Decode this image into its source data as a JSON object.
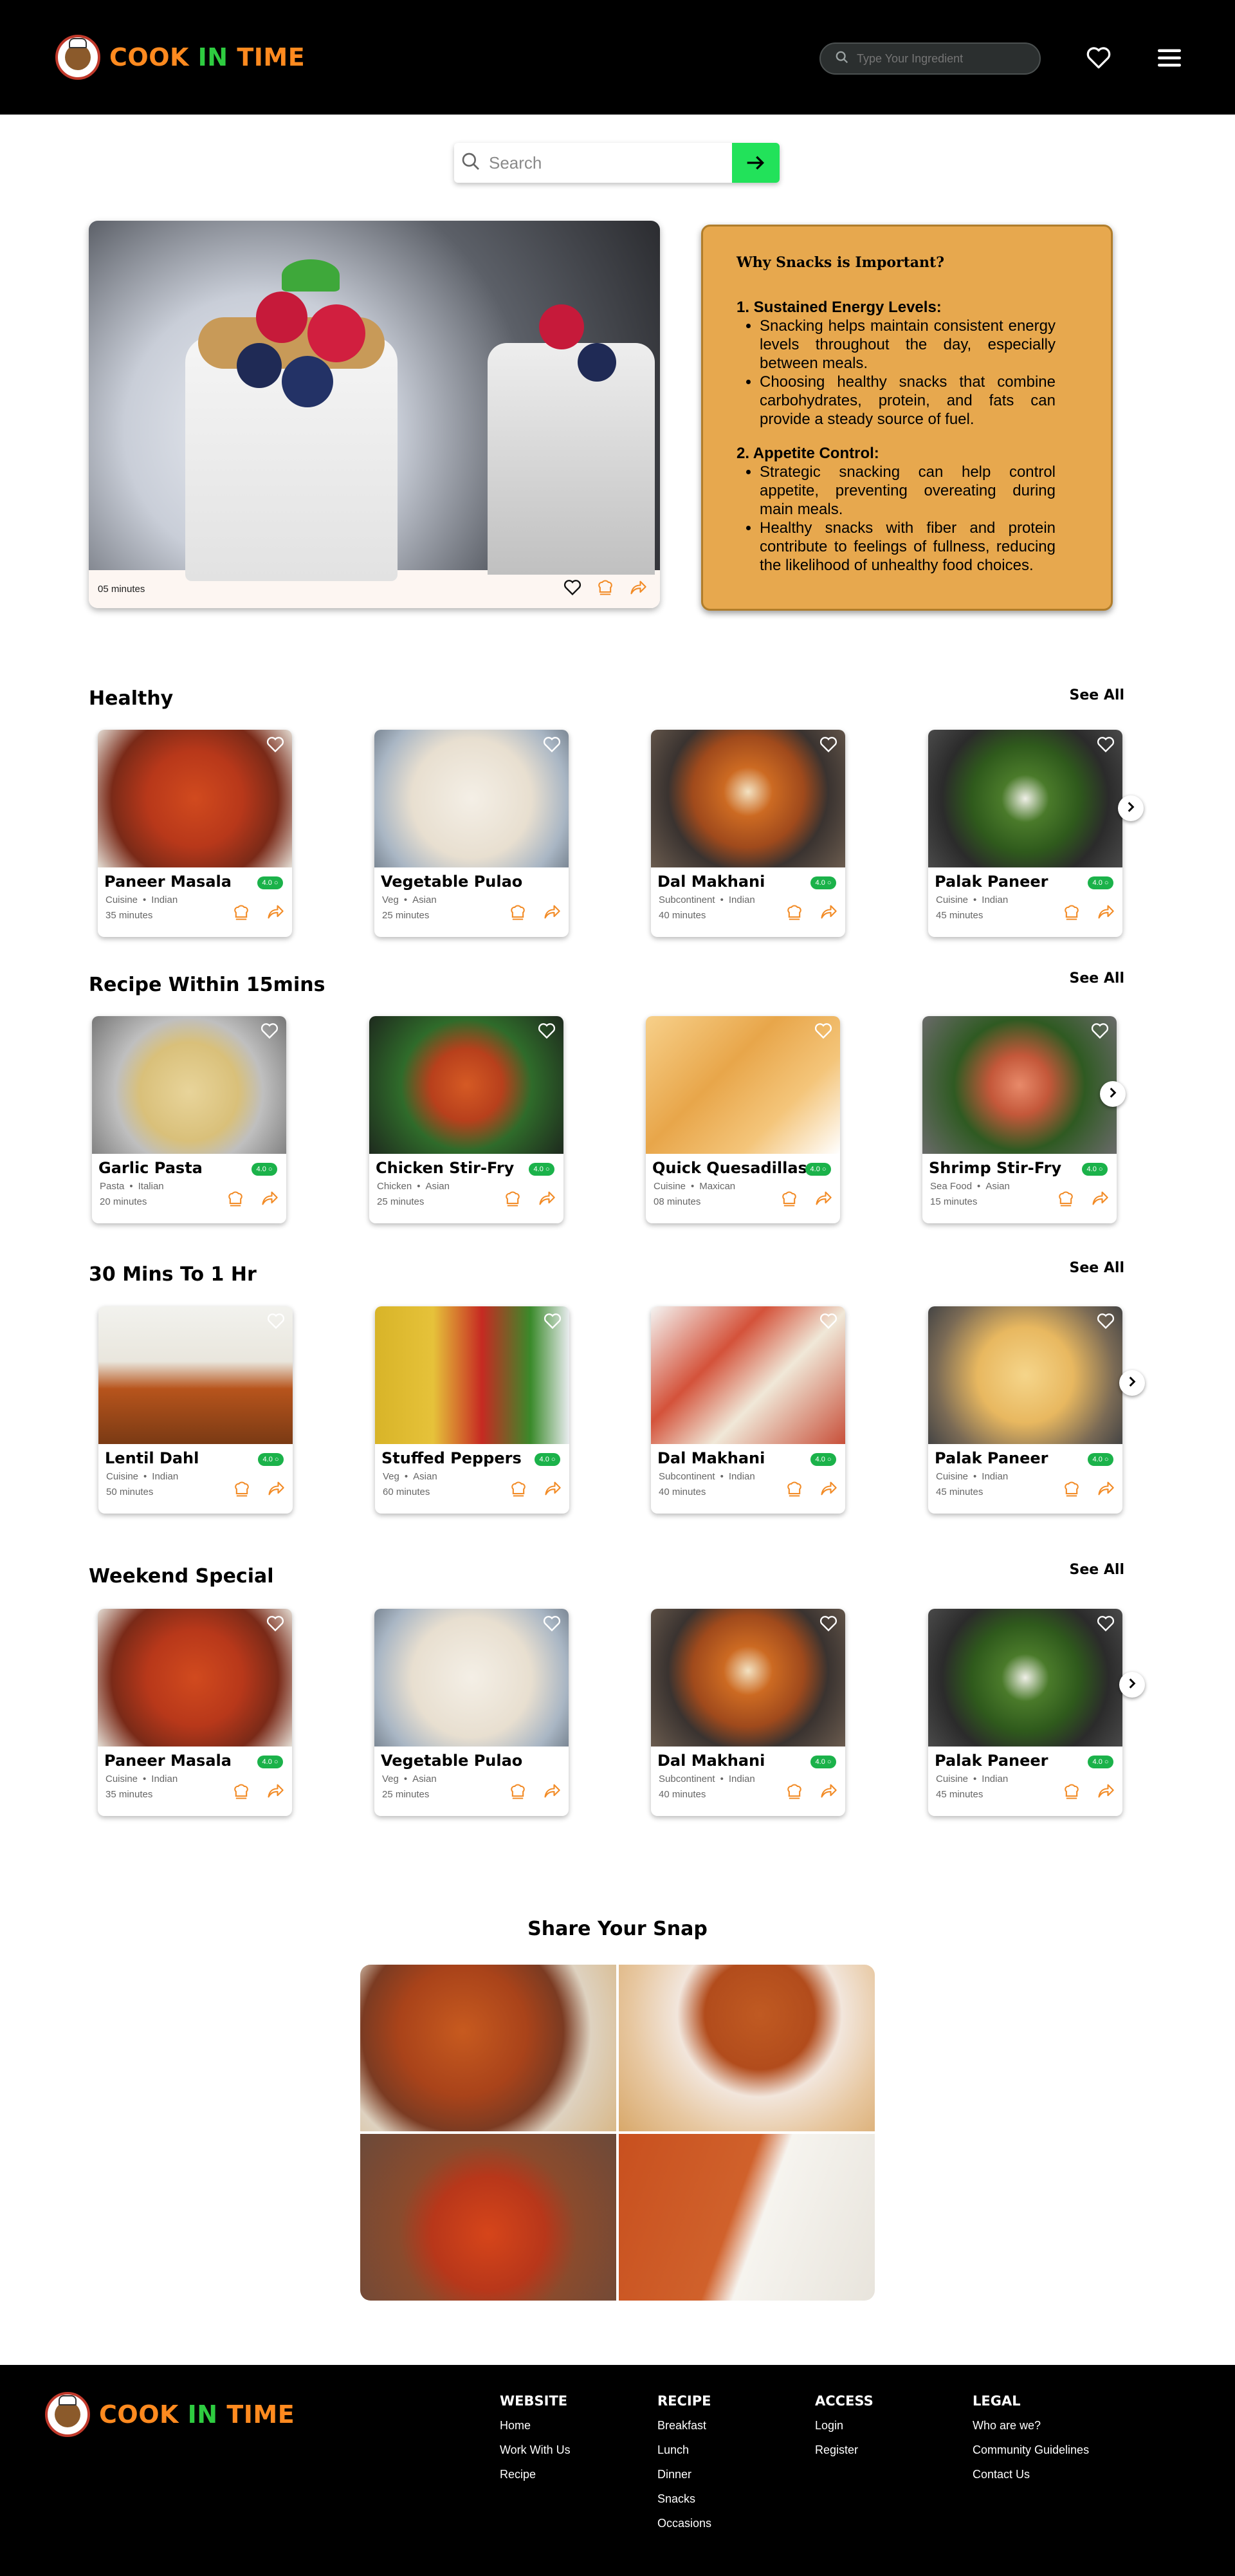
{
  "header": {
    "logo_text_1": "COOK ",
    "logo_text_2": "IN ",
    "logo_text_3": "TIME",
    "ingredient_placeholder": "Type Your Ingredient"
  },
  "search": {
    "placeholder": "Search"
  },
  "hero": {
    "time": "05 minutes"
  },
  "snack_info": {
    "title": "Why Snacks is Important?",
    "points": [
      {
        "heading": "1. Sustained Energy Levels:",
        "bullets": [
          "Snacking helps maintain consistent energy levels throughout the day, especially between meals.",
          "Choosing healthy snacks that combine carbohydrates, protein, and fats can provide a steady source of fuel."
        ]
      },
      {
        "heading": "2. Appetite Control:",
        "bullets": [
          "Strategic snacking can help control appetite, preventing overeating during main meals.",
          "Healthy snacks with fiber and protein contribute to feelings of fullness, reducing the likelihood of unhealthy food choices."
        ]
      }
    ]
  },
  "sections": [
    {
      "title": "Healthy",
      "see_all": "See All",
      "cards": [
        {
          "name": "Paneer Masala",
          "cat1": "Cuisine",
          "cat2": "Indian",
          "time": "35 minutes",
          "rating": "4.0"
        },
        {
          "name": "Vegetable Pulao",
          "cat1": "Veg",
          "cat2": "Asian",
          "time": "25 minutes",
          "rating": ""
        },
        {
          "name": "Dal Makhani",
          "cat1": "Subcontinent",
          "cat2": "Indian",
          "time": "40 minutes",
          "rating": "4.0"
        },
        {
          "name": "Palak Paneer",
          "cat1": "Cuisine",
          "cat2": "Indian",
          "time": "45 minutes",
          "rating": "4.0"
        }
      ]
    },
    {
      "title": "Recipe Within 15mins",
      "see_all": "See All",
      "cards": [
        {
          "name": "Garlic Pasta",
          "cat1": "Pasta",
          "cat2": "Italian",
          "time": "20 minutes",
          "rating": "4.0"
        },
        {
          "name": "Chicken Stir-Fry",
          "cat1": "Chicken",
          "cat2": "Asian",
          "time": "25 minutes",
          "rating": "4.0"
        },
        {
          "name": "Quick Quesadillas",
          "cat1": "Cuisine",
          "cat2": "Maxican",
          "time": "08 minutes",
          "rating": "4.0"
        },
        {
          "name": "Shrimp Stir-Fry",
          "cat1": "Sea Food",
          "cat2": "Asian",
          "time": "15 minutes",
          "rating": "4.0"
        }
      ]
    },
    {
      "title": "30 Mins To 1 Hr",
      "see_all": "See All",
      "cards": [
        {
          "name": "Lentil Dahl",
          "cat1": "Cuisine",
          "cat2": "Indian",
          "time": "50 minutes",
          "rating": "4.0"
        },
        {
          "name": "Stuffed Peppers",
          "cat1": "Veg",
          "cat2": "Asian",
          "time": "60 minutes",
          "rating": "4.0"
        },
        {
          "name": "Dal Makhani",
          "cat1": "Subcontinent",
          "cat2": "Indian",
          "time": "40 minutes",
          "rating": "4.0"
        },
        {
          "name": "Palak Paneer",
          "cat1": "Cuisine",
          "cat2": "Indian",
          "time": "45 minutes",
          "rating": "4.0"
        }
      ]
    },
    {
      "title": "Weekend Special",
      "see_all": "See All",
      "cards": [
        {
          "name": "Paneer Masala",
          "cat1": "Cuisine",
          "cat2": "Indian",
          "time": "35 minutes",
          "rating": "4.0"
        },
        {
          "name": "Vegetable Pulao",
          "cat1": "Veg",
          "cat2": "Asian",
          "time": "25 minutes",
          "rating": ""
        },
        {
          "name": "Dal Makhani",
          "cat1": "Subcontinent",
          "cat2": "Indian",
          "time": "40 minutes",
          "rating": "4.0"
        },
        {
          "name": "Palak Paneer",
          "cat1": "Cuisine",
          "cat2": "Indian",
          "time": "45 minutes",
          "rating": "4.0"
        }
      ]
    }
  ],
  "snap": {
    "title": "Share Your Snap"
  },
  "footer": {
    "columns": [
      {
        "heading": "WEBSITE",
        "links": [
          "Home",
          "Work With Us",
          "Recipe"
        ]
      },
      {
        "heading": "RECIPE",
        "links": [
          "Breakfast",
          "Lunch",
          "Dinner",
          "Snacks",
          "Occasions"
        ]
      },
      {
        "heading": "ACCESS",
        "links": [
          "Login",
          "Register"
        ]
      },
      {
        "heading": "LEGAL",
        "links": [
          "Who are we?",
          "Community Guidelines",
          "Contact Us"
        ]
      }
    ]
  },
  "colors": {
    "brand_orange": "#ff8a1f",
    "brand_green": "#2ecc40",
    "accent_orange": "#f28b26",
    "snack_box": "#e7a84e",
    "search_button": "#22e25a",
    "rating_green": "#1bb24a"
  }
}
